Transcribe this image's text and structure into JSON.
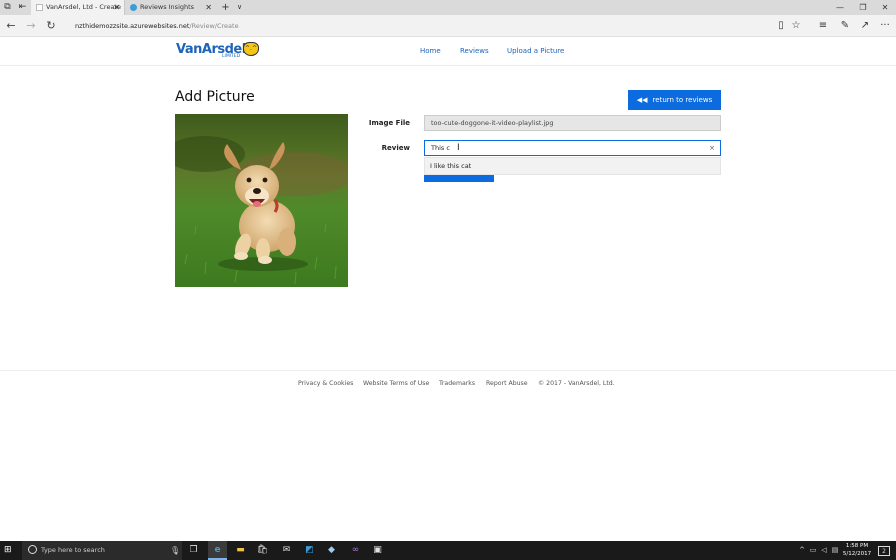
{
  "browser": {
    "tabs": [
      {
        "label": "VanArsdel, Ltd - Create",
        "active": true
      },
      {
        "label": "Reviews Insights",
        "active": false
      }
    ],
    "new_tab_symbol": "+",
    "tab_list_symbol": "∨",
    "window_controls": {
      "minimize": "—",
      "restore": "❐",
      "close": "✕"
    },
    "url_host": "nzthidemozzsite.azurewebsites.net",
    "url_path": "/Review/Create",
    "nav": {
      "back": "←",
      "forward": "→",
      "refresh": "↻"
    },
    "toolbar_icons": [
      "reading-view-icon",
      "favorite-star-icon",
      "hub-icon",
      "web-note-icon",
      "share-icon",
      "more-icon"
    ]
  },
  "site": {
    "logo_text": "VanArsdel",
    "logo_sub": "LIMITED",
    "nav": [
      "Home",
      "Reviews",
      "Upload a Picture"
    ]
  },
  "page": {
    "title": "Add Picture",
    "return_button": "return to reviews",
    "image_alt": "puppy running on grass",
    "form": {
      "image_file_label": "Image File",
      "image_file_value": "too-cute-doggone-it-video-playlist.jpg",
      "review_label": "Review",
      "review_value": "This c",
      "clear_symbol": "×",
      "suggestion": "I like this cat"
    }
  },
  "footer": {
    "links": [
      "Privacy & Cookies",
      "Website Terms of Use",
      "Trademarks",
      "Report Abuse"
    ],
    "copyright": "© 2017 - VanArsdel, Ltd."
  },
  "taskbar": {
    "search_placeholder": "Type here to search",
    "time": "1:58 PM",
    "date": "5/12/2017",
    "notification_count": "2"
  },
  "colors": {
    "accent": "#0c6bde",
    "brand": "#1d63b8",
    "tab_bar": "#dadada",
    "taskbar": "#1a1a1a"
  }
}
